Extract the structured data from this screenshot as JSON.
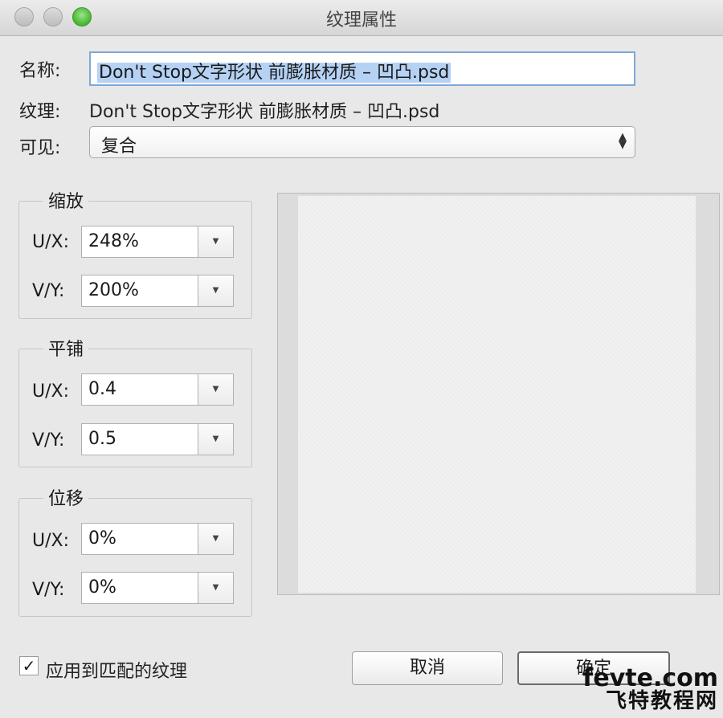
{
  "window": {
    "title": "纹理属性"
  },
  "name": {
    "label": "名称:",
    "value": "Don't Stop文字形状 前膨胀材质 – 凹凸.psd"
  },
  "texture": {
    "label": "纹理:",
    "value": "Don't Stop文字形状 前膨胀材质 – 凹凸.psd"
  },
  "visible": {
    "label": "可见:",
    "selected": "复合"
  },
  "scale": {
    "title": "缩放",
    "ux_label": "U/X:",
    "ux_value": "248%",
    "vy_label": "V/Y:",
    "vy_value": "200%"
  },
  "tile": {
    "title": "平铺",
    "ux_label": "U/X:",
    "ux_value": "0.4",
    "vy_label": "V/Y:",
    "vy_value": "0.5"
  },
  "offset": {
    "title": "位移",
    "ux_label": "U/X:",
    "ux_value": "0%",
    "vy_label": "V/Y:",
    "vy_value": "0%"
  },
  "apply_matching": {
    "label": "应用到匹配的纹理",
    "checked": true,
    "mark": "✓"
  },
  "buttons": {
    "cancel": "取消",
    "ok": "确定"
  },
  "watermark": {
    "line1": "fevte.com",
    "line2": "飞特教程网"
  },
  "icons": {
    "dropdown": "▼",
    "select_arrows": "▲▼"
  }
}
